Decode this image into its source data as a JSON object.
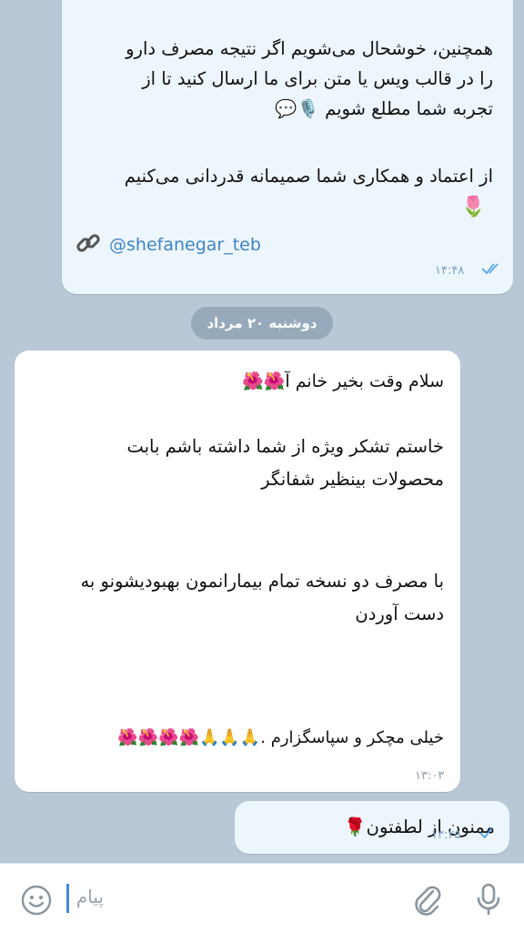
{
  "messages": {
    "top": {
      "lines": [
        "همچنین، خوشحال می‌شویم اگر نتیجه مصرف دارو",
        "را در قالب ویس یا متن برای ما ارسال کنید تا از",
        "تجربه شما مطلع شویم 🎙️💬",
        "از اعتماد و همکاری شما صمیمانه قدردانی می‌کنیم",
        "🌷"
      ],
      "link": "@shefanegar_teb",
      "time": "۱۴:۴۸"
    },
    "date_separator": "دوشنبه ۲۰ مرداد",
    "incoming": {
      "lines": [
        "سلام وقت بخیر خانم آ🌺🌺",
        "خاستم تشکر ویژه از شما داشته باشم بابت",
        "محصولات بینظیر شفانگر",
        "با مصرف دو نسخه تمام بیمارانمون بهبودیشونو به",
        "دست آوردن",
        "خیلی مچکر و سپاسگزارم .🙏🙏🙏🌺🌺🌺🌺"
      ],
      "time": "۱۳:۰۳"
    },
    "reply": {
      "text": "ممنون از لطفتون🌹",
      "time": "۱۳:۲۵"
    }
  },
  "composer": {
    "placeholder": "پیام",
    "icons": [
      "emoji-icon",
      "attach-icon",
      "microphone-icon"
    ]
  },
  "colors": {
    "background": "#b9c8d6",
    "outgoing_bubble": "#eef6fd",
    "incoming_bubble": "#ffffff",
    "link": "#3d85c6",
    "tick": "#4aa0e6"
  }
}
